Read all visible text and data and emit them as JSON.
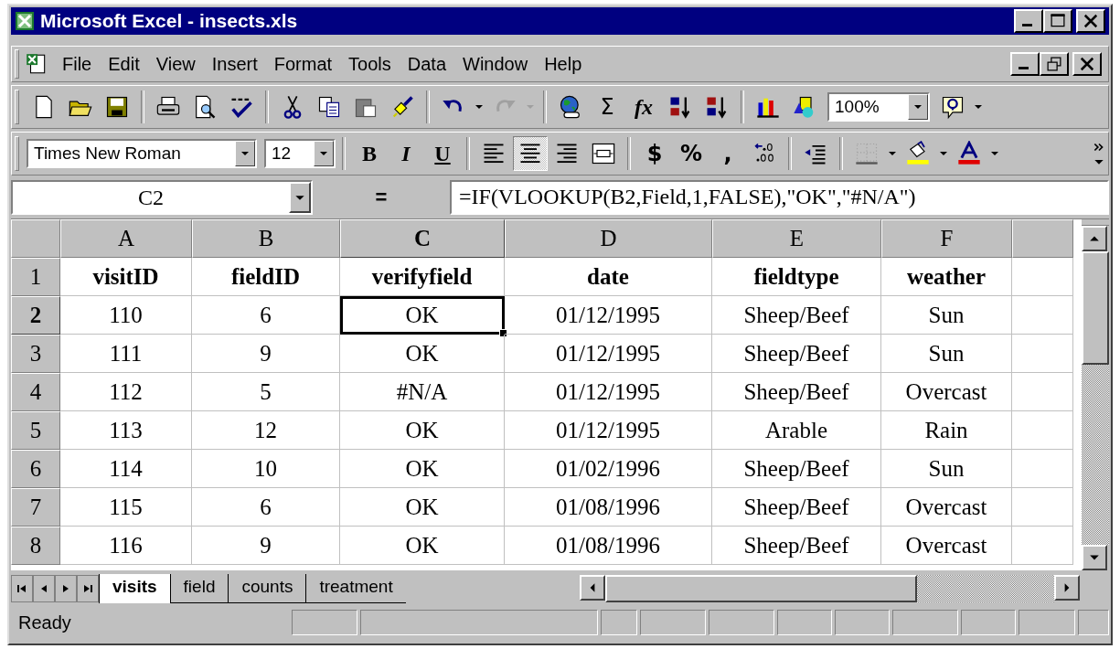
{
  "window": {
    "title": "Microsoft Excel - insects.xls"
  },
  "menu": [
    "File",
    "Edit",
    "View",
    "Insert",
    "Format",
    "Tools",
    "Data",
    "Window",
    "Help"
  ],
  "standard_toolbar": {
    "sum": "Σ",
    "function": "fx",
    "zoom": "100%"
  },
  "formatting_toolbar": {
    "font": "Times New Roman",
    "size": "12",
    "styles": [
      "B",
      "I",
      "U"
    ],
    "alignment": [
      {
        "selected": false
      },
      {
        "selected": true
      },
      {
        "selected": false
      }
    ],
    "number_formats": [
      "$",
      "%",
      ","
    ]
  },
  "formula_bar": {
    "name_box": "C2",
    "equals": "=",
    "formula": "=IF(VLOOKUP(B2,Field,1,FALSE),\"OK\",\"#N/A\")"
  },
  "sheet": {
    "columns": [
      {
        "label": "A",
        "selected": false
      },
      {
        "label": "B",
        "selected": false
      },
      {
        "label": "C",
        "selected": true
      },
      {
        "label": "D",
        "selected": false
      },
      {
        "label": "E",
        "selected": false
      },
      {
        "label": "F",
        "selected": false
      }
    ],
    "rows": [
      {
        "label": "1",
        "selected": false,
        "kind": "header",
        "cells": [
          "visitID",
          "fieldID",
          "verifyfield",
          "date",
          "fieldtype",
          "weather"
        ]
      },
      {
        "label": "2",
        "selected": true,
        "kind": "data",
        "cells": [
          "110",
          "6",
          "OK",
          "01/12/1995",
          "Sheep/Beef",
          "Sun"
        ]
      },
      {
        "label": "3",
        "selected": false,
        "kind": "data",
        "cells": [
          "111",
          "9",
          "OK",
          "01/12/1995",
          "Sheep/Beef",
          "Sun"
        ]
      },
      {
        "label": "4",
        "selected": false,
        "kind": "data",
        "cells": [
          "112",
          "5",
          "#N/A",
          "01/12/1995",
          "Sheep/Beef",
          "Overcast"
        ]
      },
      {
        "label": "5",
        "selected": false,
        "kind": "data",
        "cells": [
          "113",
          "12",
          "OK",
          "01/12/1995",
          "Arable",
          "Rain"
        ]
      },
      {
        "label": "6",
        "selected": false,
        "kind": "data",
        "cells": [
          "114",
          "10",
          "OK",
          "01/02/1996",
          "Sheep/Beef",
          "Sun"
        ]
      },
      {
        "label": "7",
        "selected": false,
        "kind": "data",
        "cells": [
          "115",
          "6",
          "OK",
          "01/08/1996",
          "Sheep/Beef",
          "Overcast"
        ]
      },
      {
        "label": "8",
        "selected": false,
        "kind": "data",
        "cells": [
          "116",
          "9",
          "OK",
          "01/08/1996",
          "Sheep/Beef",
          "Overcast"
        ]
      }
    ]
  },
  "sheet_tabs": [
    {
      "label": "visits",
      "selected": true
    },
    {
      "label": "field",
      "selected": false
    },
    {
      "label": "counts",
      "selected": false
    },
    {
      "label": "treatment",
      "selected": false
    }
  ],
  "status_bar": {
    "text": "Ready"
  }
}
